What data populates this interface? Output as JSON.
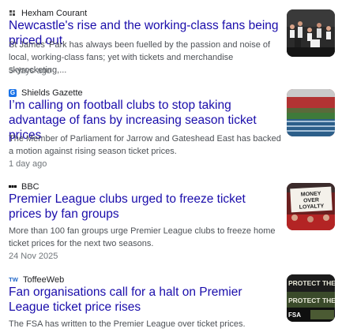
{
  "articles": [
    {
      "source": "Hexham Courant",
      "favicon_icon": "hexham-courant-logo-icon",
      "headline": "Newcastle's rise and the working-class fans being priced out",
      "snippet": "St James' Park has always been fuelled by the passion and noise of local, working-class fans; yet with tickets and merchandise skyrocketing,...",
      "date": "5 days ago"
    },
    {
      "source": "Shields Gazette",
      "favicon_icon": "shields-gazette-logo-icon",
      "favicon_text": "G",
      "headline": "I’m calling on football clubs to stop taking advantage of fans by increasing season ticket prices",
      "snippet": "The Member of Parliament for Jarrow and Gateshead East has backed a motion against rising season ticket prices.",
      "date": "1 day ago"
    },
    {
      "source": "BBC",
      "favicon_icon": "bbc-logo-icon",
      "headline": "Premier League clubs urged to freeze ticket prices by fan groups",
      "snippet": "More than 100 fan groups urge Premier League clubs to freeze home ticket prices for the next two seasons.",
      "date": "24 Nov 2025",
      "thumb_banner_lines": [
        "MONEY",
        "OVER",
        "LOYALTY"
      ]
    },
    {
      "source": "ToffeeWeb",
      "favicon_icon": "toffeeweb-logo-icon",
      "favicon_text": "TW",
      "headline": "Fan organisations call for a halt on Premier League ticket price rises",
      "snippet": "The FSA has written to the Premier League over ticket prices.",
      "thumb_banner_lines": [
        "PROTECT THE FAN",
        "PROTECT THE GAME",
        "FSA"
      ]
    }
  ],
  "colors": {
    "headline": "#1a0dab",
    "snippet": "#4d5156",
    "date": "#70757a",
    "shields_gazette_blue": "#1a73e8",
    "toffeeweb_blue": "#1f66c8"
  }
}
